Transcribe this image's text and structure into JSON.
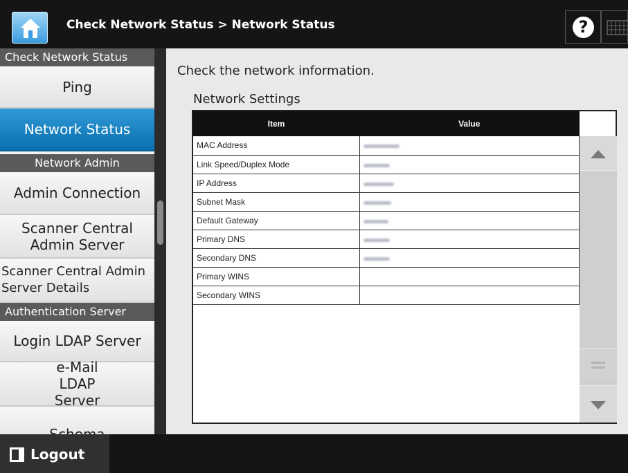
{
  "header": {
    "title": "Check Network Status > Network Status",
    "help_glyph": "?",
    "icons": [
      "home-icon",
      "help-icon",
      "keyboard-icon"
    ]
  },
  "sidebar": {
    "sections": {
      "check_network_status": "Check Network Status",
      "network_admin": "Network Admin",
      "authentication_server": "Authentication Server"
    },
    "items": [
      {
        "label": "Ping"
      },
      {
        "label": "Network Status"
      },
      {
        "label": "Admin Connection"
      },
      {
        "label": "Scanner Central Admin Server"
      },
      {
        "label": "Scanner Central Admin Server Details"
      },
      {
        "label": "Login LDAP Server"
      },
      {
        "label": "e-Mail LDAP Server"
      },
      {
        "label": "Schema"
      }
    ],
    "active_item": "Network Status"
  },
  "main": {
    "instruction": "Check the network information.",
    "section_title": "Network Settings",
    "table": {
      "headers": [
        "Item",
        "Value"
      ],
      "rows": [
        {
          "item": "MAC Address",
          "value_obscured": true
        },
        {
          "item": "Link Speed/Duplex Mode",
          "value_obscured": true
        },
        {
          "item": "IP Address",
          "value_obscured": true
        },
        {
          "item": "Subnet Mask",
          "value_obscured": true
        },
        {
          "item": "Default Gateway",
          "value_obscured": true
        },
        {
          "item": "Primary DNS",
          "value_obscured": true
        },
        {
          "item": "Secondary DNS",
          "value_obscured": true
        },
        {
          "item": "Primary WINS",
          "value_obscured": false
        },
        {
          "item": "Secondary WINS",
          "value_obscured": false
        }
      ]
    }
  },
  "footer": {
    "logout_label": "Logout"
  },
  "colors": {
    "active_item": "#1a84c6",
    "header_bg": "#151515",
    "section_bg": "#5a5a5a"
  }
}
